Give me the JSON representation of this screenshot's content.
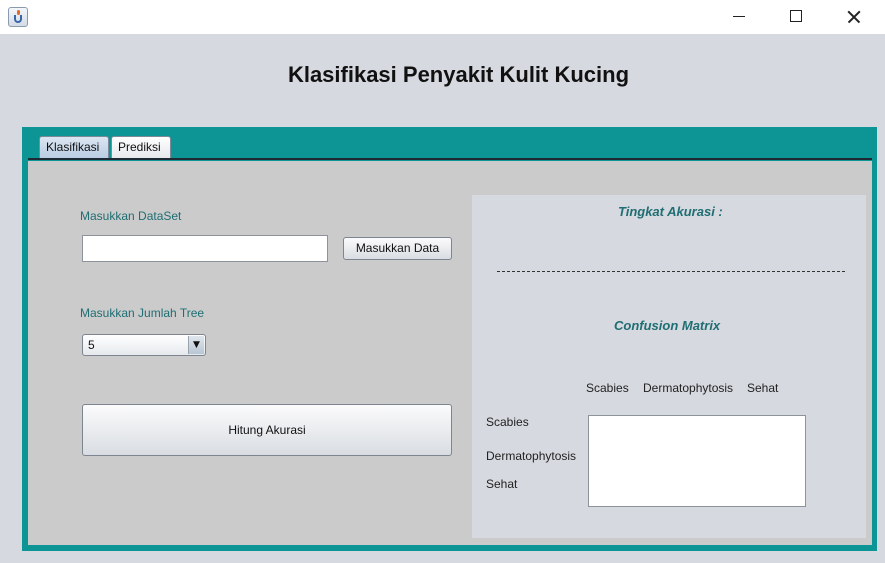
{
  "window": {
    "icon": "java-icon",
    "controls": [
      "minimize-icon",
      "maximize-icon",
      "close-icon"
    ]
  },
  "app": {
    "title": "Klasifikasi Penyakit Kulit Kucing"
  },
  "tabs": [
    {
      "label": "Klasifikasi",
      "selected": true
    },
    {
      "label": "Prediksi",
      "selected": false
    }
  ],
  "form": {
    "dataset_label": "Masukkan DataSet",
    "dataset_value": "",
    "load_button": "Masukkan Data",
    "tree_label": "Masukkan Jumlah Tree",
    "tree_value": "5",
    "calc_button": "Hitung Akurasi"
  },
  "result": {
    "accuracy_label": "Tingkat Akurasi  :",
    "matrix_title": "Confusion Matrix",
    "columns": [
      "Scabies",
      "Dermatophytosis",
      "Sehat"
    ],
    "rows": [
      "Scabies",
      "Dermatophytosis",
      "Sehat"
    ]
  },
  "colors": {
    "accent": "#0d9595",
    "label_teal": "#1f6e73"
  }
}
